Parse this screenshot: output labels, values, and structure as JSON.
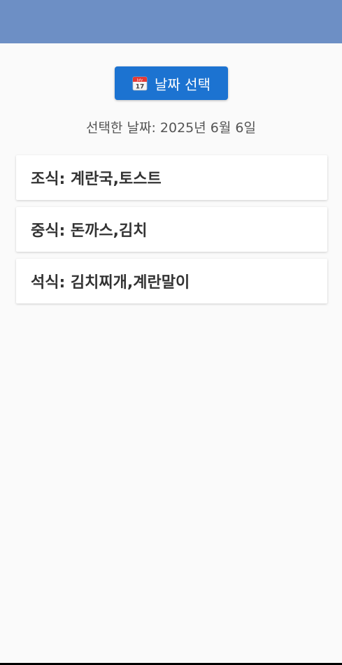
{
  "app_bar": {
    "color": "#6d8fc5"
  },
  "date_button": {
    "icon": "calendar-icon",
    "icon_month": "July",
    "icon_day": "17",
    "label": "날짜 선택",
    "color": "#1c73d1"
  },
  "selected_date_text": "선택한 날짜: 2025년 6월 6일",
  "meals": [
    {
      "text": "조식: 계란국,토스트"
    },
    {
      "text": "중식: 돈까스,김치"
    },
    {
      "text": "석식: 김치찌개,계란말이"
    }
  ]
}
